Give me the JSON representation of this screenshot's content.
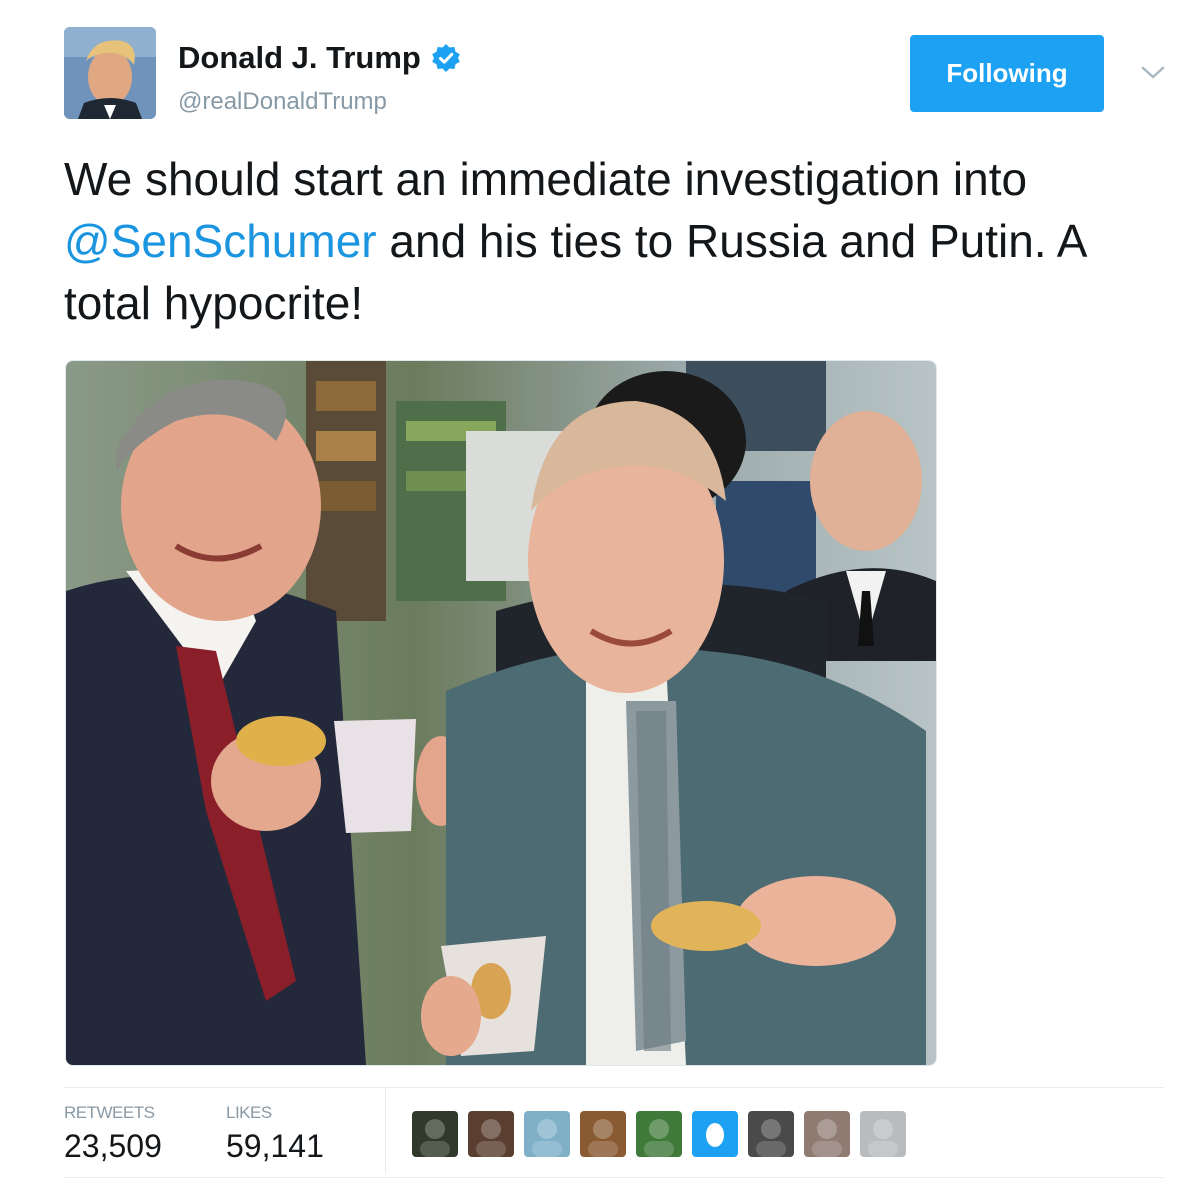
{
  "author": {
    "display_name": "Donald J. Trump",
    "handle": "@realDonaldTrump",
    "verified": true
  },
  "follow_button": {
    "label": "Following"
  },
  "tweet": {
    "text_before": "We should start an immediate investigation into ",
    "mention": "@SenSchumer",
    "text_after": " and his ties to Russia and Putin. A total hypocrite!"
  },
  "stats": {
    "retweets_label": "RETWEETS",
    "retweets_value": "23,509",
    "likes_label": "LIKES",
    "likes_value": "59,141"
  },
  "likers": [
    {
      "name": "liker-avatar-1",
      "color": "#2f3a2a"
    },
    {
      "name": "liker-avatar-2",
      "color": "#5a3f30"
    },
    {
      "name": "liker-avatar-3",
      "color": "#7fb0c8"
    },
    {
      "name": "liker-avatar-4",
      "color": "#8a5a32"
    },
    {
      "name": "liker-avatar-5",
      "color": "#3f7a3a"
    },
    {
      "name": "liker-avatar-6",
      "color": "#1da1f2"
    },
    {
      "name": "liker-avatar-7",
      "color": "#4a4a4a"
    },
    {
      "name": "liker-avatar-8",
      "color": "#8f7b72"
    },
    {
      "name": "liker-avatar-9",
      "color": "#b9bcbf"
    }
  ],
  "colors": {
    "accent": "#1da1f2",
    "mention": "#1b95e0",
    "muted": "#8899a6"
  }
}
